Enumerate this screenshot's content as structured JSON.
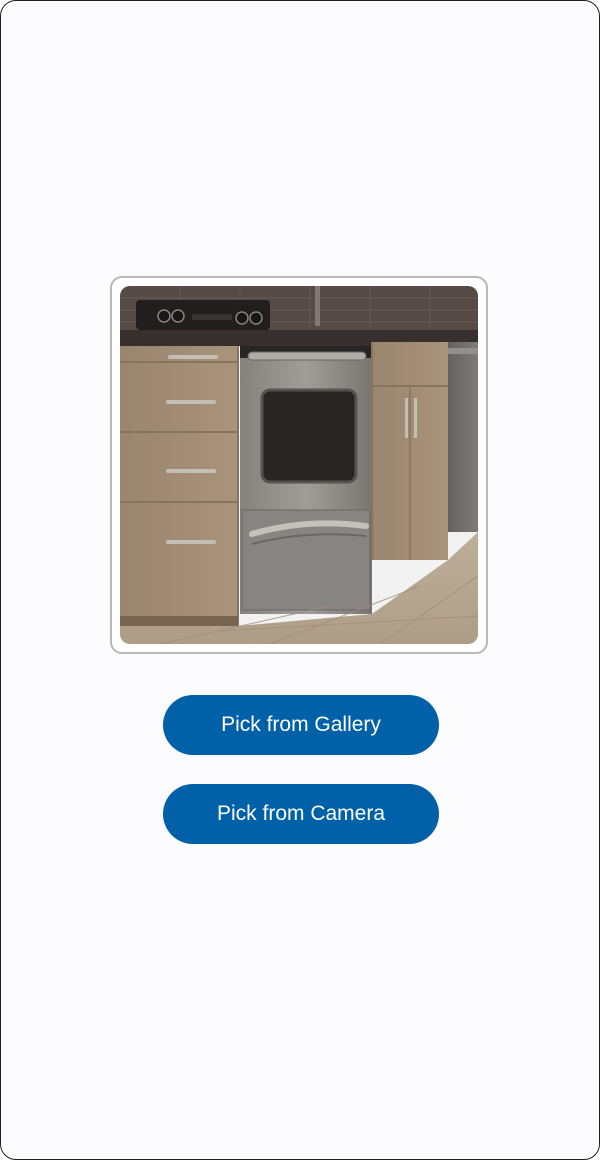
{
  "image": {
    "subject": "kitchen-stove-photo"
  },
  "actions": {
    "gallery_label": "Pick from Gallery",
    "camera_label": "Pick from Camera"
  },
  "colors": {
    "accent": "#0061a8",
    "background": "#fcfcff",
    "card_border": "#b9b9bd"
  }
}
